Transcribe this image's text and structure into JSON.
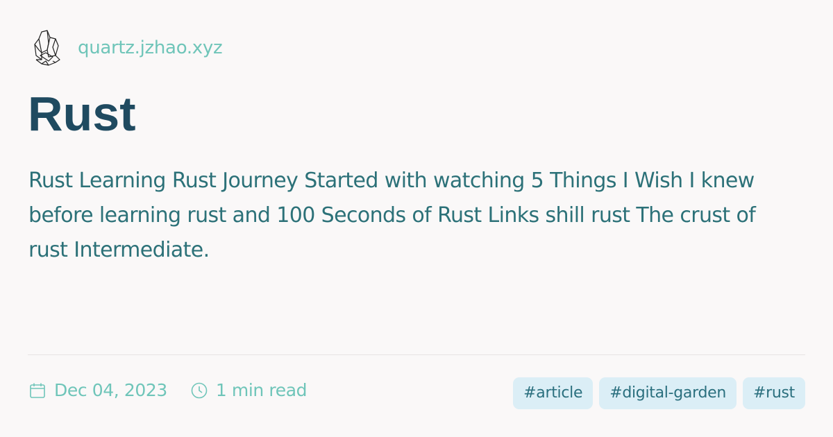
{
  "site": {
    "name": "quartz.jzhao.xyz",
    "logo_icon": "crystal-icon"
  },
  "page": {
    "title": "Rust",
    "description": "Rust Learning Rust Journey Started with watching 5 Things I Wish I knew before learning rust and 100 Seconds of Rust Links shill rust The crust of rust Intermediate."
  },
  "meta": {
    "date": "Dec 04, 2023",
    "date_icon": "calendar-icon",
    "reading_time": "1 min read",
    "reading_icon": "clock-icon"
  },
  "tags": [
    "#article",
    "#digital-garden",
    "#rust"
  ],
  "colors": {
    "background": "#faf8f8",
    "title": "#1f4a60",
    "description": "#2c7178",
    "accent": "#6fc5b9",
    "tag_bg": "#dbeef6",
    "tag_text": "#2a6f7e"
  }
}
